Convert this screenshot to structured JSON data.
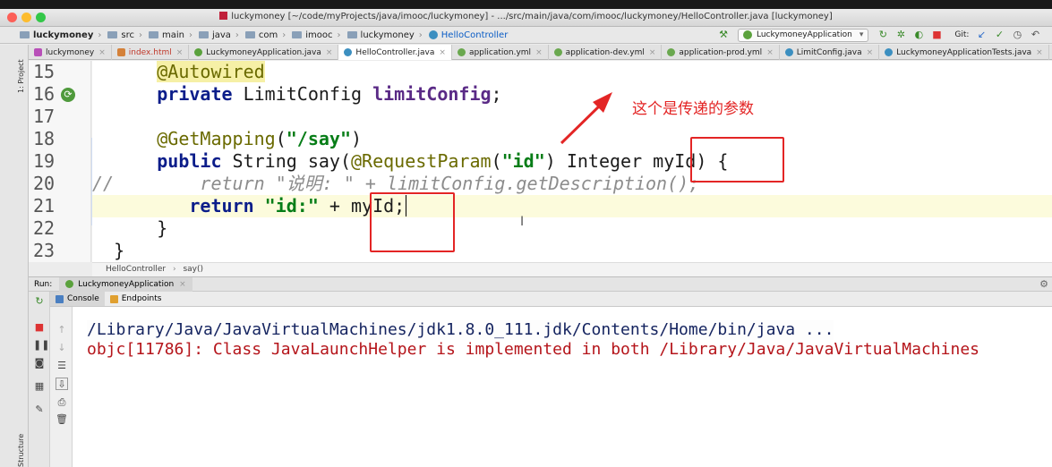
{
  "window": {
    "title": "luckymoney [~/code/myProjects/java/imooc/luckymoney] - .../src/main/java/com/imooc/luckymoney/HelloController.java [luckymoney]"
  },
  "breadcrumb": {
    "items": [
      "luckymoney",
      "src",
      "main",
      "java",
      "com",
      "imooc",
      "luckymoney",
      "HelloController"
    ]
  },
  "toolbar": {
    "run_config": "LuckymoneyApplication",
    "git_label": "Git:"
  },
  "tabs": [
    {
      "label": "luckymoney",
      "icon": "m-icon",
      "active": false
    },
    {
      "label": "index.html",
      "icon": "html-icon",
      "active": false
    },
    {
      "label": "LuckymoneyApplication.java",
      "icon": "spring-class-icon",
      "active": false
    },
    {
      "label": "HelloController.java",
      "icon": "class-icon",
      "active": true
    },
    {
      "label": "application.yml",
      "icon": "yml-icon",
      "active": false
    },
    {
      "label": "application-dev.yml",
      "icon": "yml-icon",
      "active": false
    },
    {
      "label": "application-prod.yml",
      "icon": "yml-icon",
      "active": false
    },
    {
      "label": "LimitConfig.java",
      "icon": "class-icon",
      "active": false
    },
    {
      "label": "LuckymoneyApplicationTests.java",
      "icon": "test-class-icon",
      "active": false
    }
  ],
  "side": {
    "project_label": "1: Project",
    "structure_label": "Structure"
  },
  "editor": {
    "line_numbers": [
      "15",
      "16",
      "17",
      "18",
      "19",
      "20",
      "21",
      "22",
      "23"
    ],
    "code": {
      "l15_ann": "@Autowired",
      "l16_kw": "private",
      "l16_type": " LimitConfig ",
      "l16_field": "limitConfig",
      "l16_end": ";",
      "l18_ann": "@GetMapping",
      "l18_open": "(",
      "l18_str": "\"/say\"",
      "l18_close": ")",
      "l19_kw": "public",
      "l19_sig": " String say(",
      "l19_ann": "@RequestParam",
      "l19_open": "(",
      "l19_str": "\"id\"",
      "l19_rest": ") Integer myId) {",
      "l20_slashes": "//",
      "l20_comment": "return \"说明: \" + limitConfig.getDescription();",
      "l21_kw": "return",
      "l21_str": "\"id:\"",
      "l21_rest": " + myId;",
      "l22_brace": "}",
      "l23_brace": "}"
    },
    "annotation_note": "这个是传递的参数",
    "breadcrumb": {
      "cls": "HelloController",
      "method": "say()"
    }
  },
  "run_panel": {
    "label": "Run:",
    "tab": "LuckymoneyApplication",
    "subtabs": [
      "Console",
      "Endpoints"
    ],
    "console_lines": [
      "/Library/Java/JavaVirtualMachines/jdk1.8.0_111.jdk/Contents/Home/bin/java ...",
      "objc[11786]: Class JavaLaunchHelper is implemented in both /Library/Java/JavaVirtualMachines"
    ]
  },
  "colors": {
    "annotation_red": "#e32525",
    "keyword": "#0b1d8a",
    "string": "#067d17",
    "console_error": "#b5151b"
  }
}
